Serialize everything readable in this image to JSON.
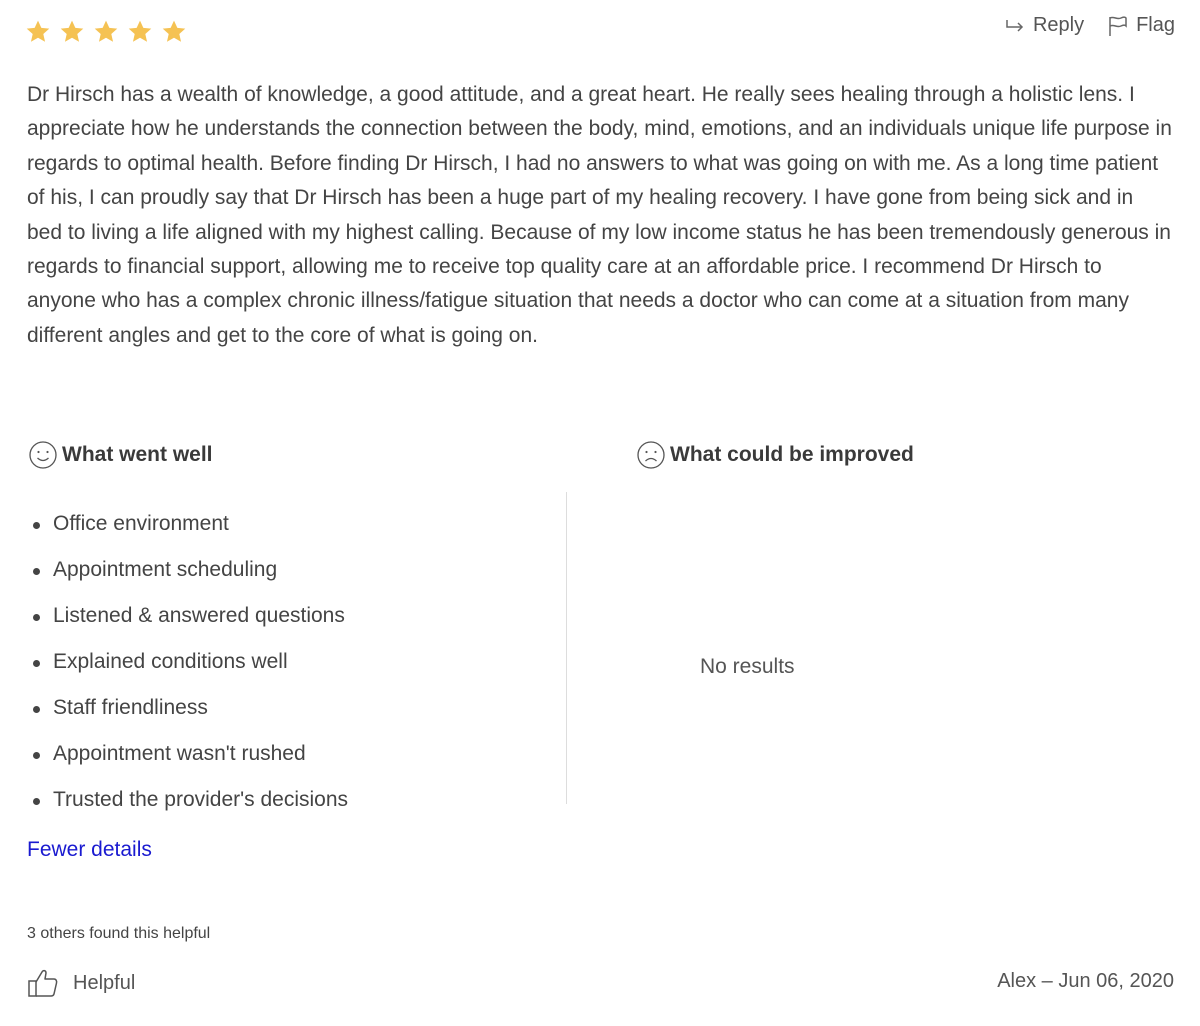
{
  "rating": {
    "value": 5,
    "max": 5,
    "star_color": "#F5C253"
  },
  "actions": {
    "reply_label": "Reply",
    "reply_icon": "reply-arrow-icon",
    "flag_label": "Flag",
    "flag_icon": "flag-icon"
  },
  "review": {
    "text": "Dr Hirsch has a wealth of knowledge, a good attitude, and a great heart. He really sees healing through a holistic lens. I appreciate how he understands the connection between the body, mind, emotions, and an individuals unique life purpose in regards to optimal health. Before finding Dr Hirsch, I had no answers to what was going on with me. As a long time patient of his, I can proudly say that Dr Hirsch has been a huge part of my healing recovery. I have gone from being sick and in bed to living a life aligned with my highest calling. Because of my low income status he has been tremendously generous in regards to financial support, allowing me to receive top quality care at an affordable price. I recommend Dr Hirsch to anyone who has a complex chronic illness/fatigue situation that needs a doctor who can come at a situation from many different angles and get to the core of what is going on."
  },
  "went_well": {
    "title": "What went well",
    "icon": "smiley-face-icon",
    "items": [
      "Office environment",
      "Appointment scheduling",
      "Listened & answered questions",
      "Explained conditions well",
      "Staff friendliness",
      "Appointment wasn't rushed",
      "Trusted the provider's decisions"
    ]
  },
  "could_improve": {
    "title": "What could be improved",
    "icon": "frowning-face-icon",
    "empty_text": "No results"
  },
  "toggle_details_label": "Fewer details",
  "helpful": {
    "count_text": "3 others found this helpful",
    "button_label": "Helpful",
    "icon": "thumbs-up-icon"
  },
  "author": {
    "name": "Alex",
    "separator": "–",
    "date": "Jun 06, 2020"
  },
  "colors": {
    "link": "#1A1AD0",
    "text": "#444444",
    "divider": "#DDDDDD"
  }
}
